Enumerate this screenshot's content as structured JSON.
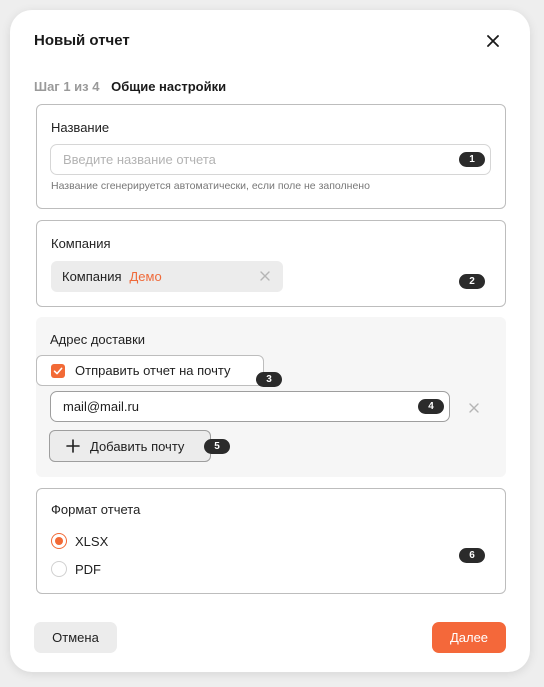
{
  "dialog": {
    "title": "Новый отчет",
    "close_icon": "close-icon"
  },
  "step": {
    "counter": "Шаг 1 из 4",
    "name": "Общие настройки"
  },
  "name_section": {
    "label": "Название",
    "input_value": "",
    "input_placeholder": "Введите название отчета",
    "hint": "Название сгенерируется автоматически, если поле не заполнено",
    "badge": "1"
  },
  "company_section": {
    "label": "Компания",
    "chip_name": "Компания",
    "chip_value": "Демо",
    "chip_clear_icon": "clear-icon",
    "badge": "2"
  },
  "delivery_section": {
    "label": "Адрес доставки",
    "send_checkbox_label": "Отправить отчет на почту",
    "send_checked": true,
    "checkbox_badge": "3",
    "email_value": "mail@mail.ru",
    "email_badge": "4",
    "remove_email_icon": "remove-icon",
    "add_email_label": "Добавить почту",
    "add_icon": "plus-icon",
    "add_badge": "5"
  },
  "format_section": {
    "label": "Формат отчета",
    "options": [
      {
        "label": "XLSX",
        "selected": true
      },
      {
        "label": "PDF",
        "selected": false
      }
    ],
    "badge": "6"
  },
  "footer": {
    "cancel_label": "Отмена",
    "next_label": "Далее"
  },
  "colors": {
    "accent": "#f4683a",
    "chip_value": "#ef6a3a",
    "badge_bg": "#2b2b2b"
  }
}
